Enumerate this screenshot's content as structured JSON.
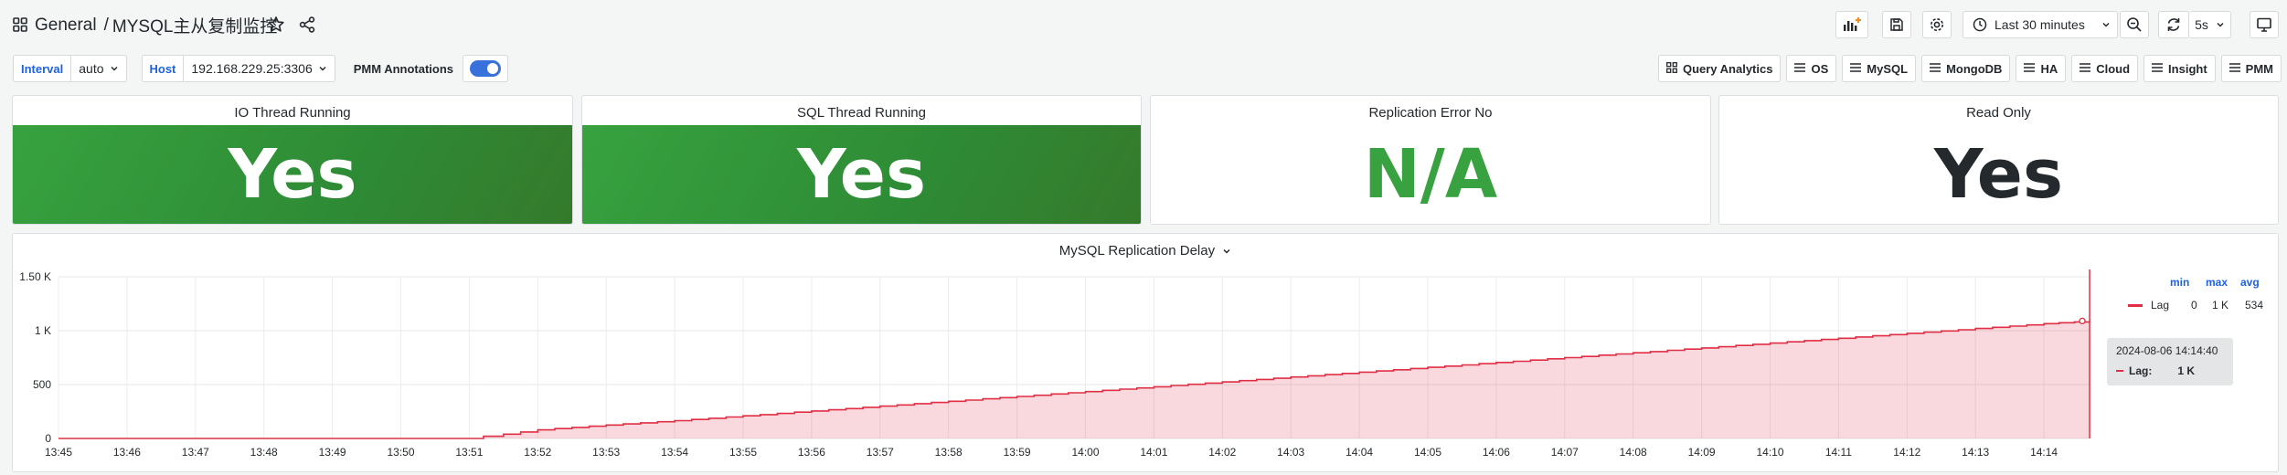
{
  "nav": {
    "folder": "General",
    "separator": "/",
    "dashboard_title": "MYSQL主从复制监控",
    "time_range": "Last 30 minutes",
    "refresh_interval": "5s"
  },
  "variables": {
    "interval_label": "Interval",
    "interval_value": "auto",
    "host_label": "Host",
    "host_value": "192.168.229.25:3306",
    "annotations_label": "PMM Annotations",
    "annotations_on": true
  },
  "links": [
    "Query Analytics",
    "OS",
    "MySQL",
    "MongoDB",
    "HA",
    "Cloud",
    "Insight",
    "PMM"
  ],
  "stats": [
    {
      "title": "IO Thread Running",
      "value": "Yes",
      "style": "green-background"
    },
    {
      "title": "SQL Thread Running",
      "value": "Yes",
      "style": "green-background"
    },
    {
      "title": "Replication Error No",
      "value": "N/A",
      "style": "green-text",
      "color": "#37a23f"
    },
    {
      "title": "Read Only",
      "value": "Yes",
      "style": "dark-text",
      "color": "#24292e"
    }
  ],
  "graph": {
    "title": "MySQL Replication Delay",
    "legend_headers": [
      "min",
      "max",
      "avg"
    ],
    "legend_series": {
      "name": "Lag",
      "min": "0",
      "max": "1 K",
      "avg": "534"
    },
    "tooltip": {
      "time": "2024-08-06 14:14:40",
      "series": "Lag:",
      "value": "1 K"
    }
  },
  "chart_data": {
    "type": "area",
    "title": "MySQL Replication Delay",
    "xlabel": "",
    "ylabel": "",
    "x_ticks": [
      "13:45",
      "13:46",
      "13:47",
      "13:48",
      "13:49",
      "13:50",
      "13:51",
      "13:52",
      "13:53",
      "13:54",
      "13:55",
      "13:56",
      "13:57",
      "13:58",
      "13:59",
      "14:00",
      "14:01",
      "14:02",
      "14:03",
      "14:04",
      "14:05",
      "14:06",
      "14:07",
      "14:08",
      "14:09",
      "14:10",
      "14:11",
      "14:12",
      "14:13",
      "14:14"
    ],
    "y_ticks": [
      "0",
      "500",
      "1 K",
      "1.50 K"
    ],
    "ylim": [
      0,
      1500
    ],
    "xlim": [
      "13:45:00",
      "14:14:40"
    ],
    "grid": true,
    "legend": "right",
    "series": [
      {
        "name": "Lag",
        "color": "#e02f44",
        "x": [
          "13:45:00",
          "13:50:55",
          "13:51:30",
          "13:52:00",
          "13:53:00",
          "13:54:00",
          "13:55:00",
          "13:56:00",
          "13:57:00",
          "13:58:00",
          "13:59:00",
          "14:00:00",
          "14:01:00",
          "14:02:00",
          "14:03:00",
          "14:04:00",
          "14:05:00",
          "14:06:00",
          "14:07:00",
          "14:08:00",
          "14:09:00",
          "14:10:00",
          "14:11:00",
          "14:12:00",
          "14:13:00",
          "14:14:00",
          "14:14:40"
        ],
        "y": [
          0,
          0,
          40,
          80,
          125,
          165,
          210,
          255,
          300,
          345,
          390,
          435,
          480,
          525,
          570,
          615,
          660,
          705,
          750,
          795,
          840,
          885,
          930,
          975,
          1020,
          1065,
          1090
        ]
      }
    ]
  }
}
